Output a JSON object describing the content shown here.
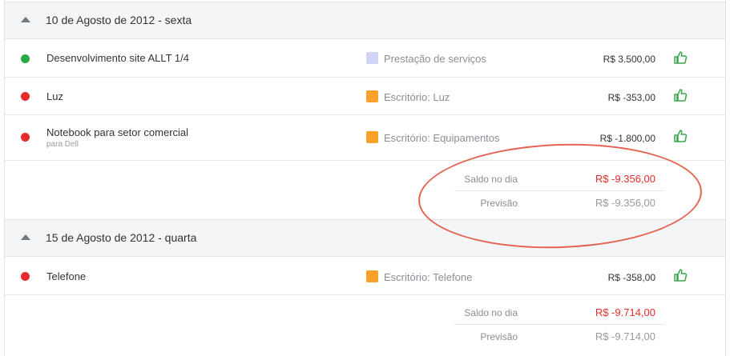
{
  "days": [
    {
      "title": "10 de Agosto de 2012 - sexta",
      "entries": [
        {
          "description": "Desenvolvimento site ALLT 1/4",
          "sub": "",
          "status": "green",
          "category": "Prestação de serviços",
          "category_color": "#d4d4f7",
          "amount": "R$ 3.500,00",
          "icon": "thumbs-up-icon"
        },
        {
          "description": "Luz",
          "sub": "",
          "status": "red",
          "category": "Escritório: Luz",
          "category_color": "#f9a12b",
          "amount": "R$ -353,00",
          "icon": "thumbs-up-icon"
        },
        {
          "description": "Notebook para setor comercial",
          "sub": "para Dell",
          "status": "red",
          "category": "Escritório: Equipamentos",
          "category_color": "#f9a12b",
          "amount": "R$ -1.800,00",
          "icon": "thumbs-up-icon"
        }
      ],
      "summary": {
        "balance_label": "Saldo no dia",
        "balance_value": "R$ -9.356,00",
        "forecast_label": "Previsão",
        "forecast_value": "R$ -9.356,00"
      }
    },
    {
      "title": "15 de Agosto de 2012 - quarta",
      "entries": [
        {
          "description": "Telefone",
          "sub": "",
          "status": "red",
          "category": "Escritório: Telefone",
          "category_color": "#f9a12b",
          "amount": "R$ -358,00",
          "icon": "thumbs-up-icon"
        }
      ],
      "summary": {
        "balance_label": "Saldo no dia",
        "balance_value": "R$ -9.714,00",
        "forecast_label": "Previsão",
        "forecast_value": "R$ -9.714,00"
      }
    }
  ],
  "colors": {
    "positive_status": "#27a943",
    "negative_status": "#e52b2b",
    "negative_value": "#e52b2b",
    "annotation": "#e46452",
    "thumb_icon": "#3aa647"
  }
}
